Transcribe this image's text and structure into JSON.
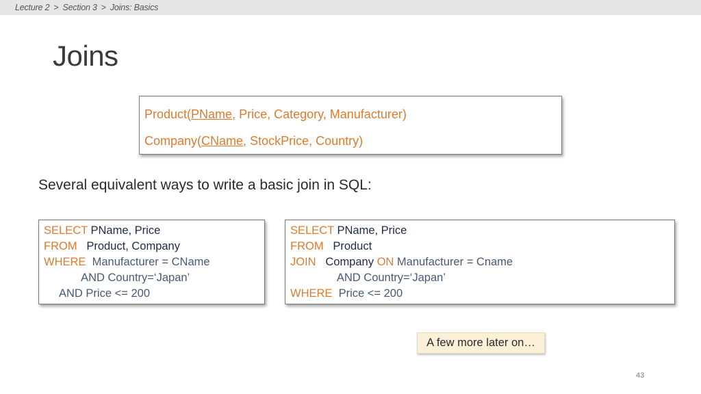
{
  "breadcrumb": {
    "items": [
      "Lecture 2",
      "Section 3",
      "Joins: Basics"
    ],
    "separator": ">"
  },
  "title": "Joins",
  "schema": {
    "product": {
      "prefix": "Product(",
      "key": "PName",
      "rest": ", Price, Category, Manufacturer)"
    },
    "company": {
      "prefix": "Company(",
      "key": "CName",
      "rest": ", StockPrice, Country)"
    }
  },
  "subtitle": "Several equivalent ways to write a basic join in SQL:",
  "query_left": {
    "line1_kw": "SELECT",
    "line1_rest": " PName, Price",
    "line2_kw": "FROM",
    "line2_rest": "   Product, Company",
    "line3_kw": "WHERE",
    "line3_rest": "  Manufacturer = CName",
    "line4": "            AND Country=‘Japan’",
    "line5": "     AND Price <= 200"
  },
  "query_right": {
    "line1_kw": "SELECT",
    "line1_rest": " PName, Price",
    "line2_kw": "FROM",
    "line2_rest": "   Product",
    "line3_kw": "JOIN",
    "line3_mid": "   Company ",
    "line3_kw2": "ON",
    "line3_rest": " Manufacturer = Cname",
    "line4": "               AND Country=‘Japan’",
    "line5_kw": "WHERE",
    "line5_rest": "  Price <= 200"
  },
  "note": "A few more later on…",
  "page_number": "43",
  "colors": {
    "keyword": "#e07b2e",
    "text": "#1f2a44",
    "note_bg": "#fdf0d8"
  }
}
